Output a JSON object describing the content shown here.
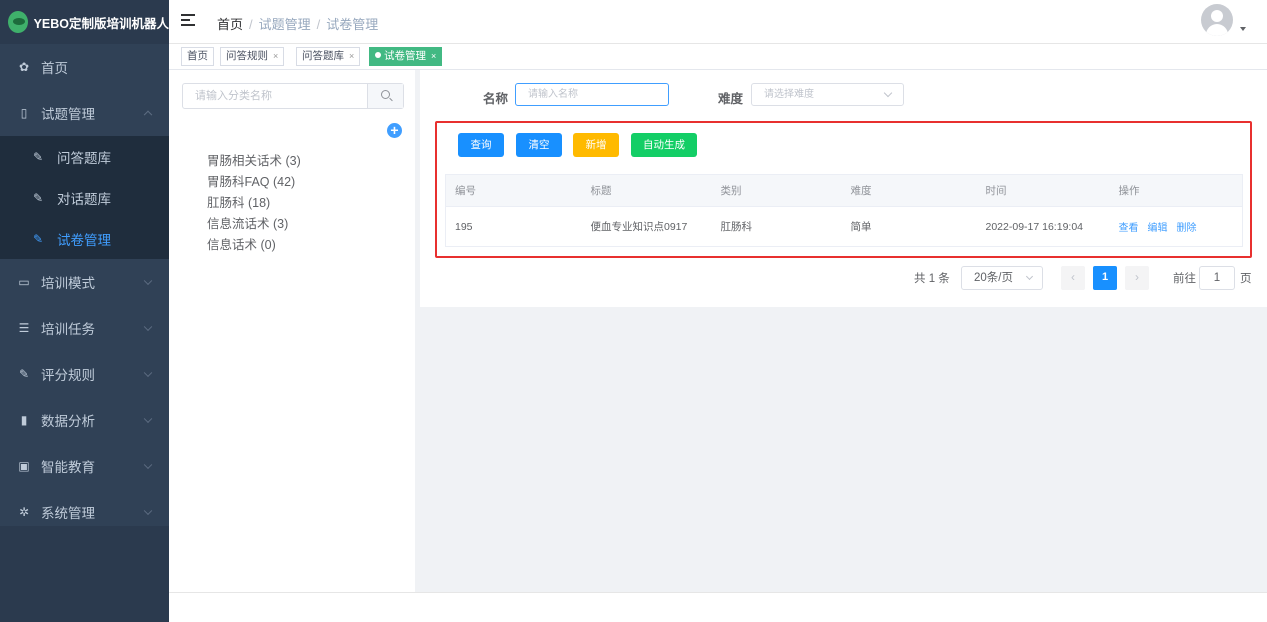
{
  "app": {
    "title": "YEBO定制版培训机器人"
  },
  "sidebar": {
    "items": [
      {
        "label": "首页",
        "icon": "dashboard-icon",
        "glyph": "✿"
      },
      {
        "label": "试题管理",
        "icon": "book-icon",
        "glyph": "▯",
        "expanded": true,
        "children": [
          {
            "label": "问答题库",
            "icon": "edit-icon",
            "glyph": "✎"
          },
          {
            "label": "对话题库",
            "icon": "edit-icon",
            "glyph": "✎"
          },
          {
            "label": "试卷管理",
            "icon": "edit-icon",
            "glyph": "✎",
            "active": true
          }
        ]
      },
      {
        "label": "培训模式",
        "icon": "monitor-icon",
        "glyph": "▭"
      },
      {
        "label": "培训任务",
        "icon": "list-icon",
        "glyph": "☰"
      },
      {
        "label": "评分规则",
        "icon": "edit-icon",
        "glyph": "✎"
      },
      {
        "label": "数据分析",
        "icon": "bar-chart-icon",
        "glyph": "▮"
      },
      {
        "label": "智能教育",
        "icon": "screen-icon",
        "glyph": "▣"
      },
      {
        "label": "系统管理",
        "icon": "gear-icon",
        "glyph": "✲"
      }
    ]
  },
  "header": {
    "breadcrumb": {
      "home": "首页",
      "parent": "试题管理",
      "current": "试卷管理"
    }
  },
  "tags": [
    {
      "label": "首页",
      "closable": false
    },
    {
      "label": "问答规则",
      "closable": true
    },
    {
      "label": "问答题库",
      "closable": true
    },
    {
      "label": "试卷管理",
      "closable": true,
      "active": true
    }
  ],
  "tree": {
    "search_placeholder": "请输入分类名称",
    "nodes": [
      "胃肠相关话术 (3)",
      "胃肠科FAQ (42)",
      "肛肠科 (18)",
      "信息流话术 (3)",
      "信息话术 (0)"
    ]
  },
  "filters": {
    "name_label": "名称",
    "name_placeholder": "请输入名称",
    "difficulty_label": "难度",
    "difficulty_placeholder": "请选择难度"
  },
  "buttons": {
    "query": "查询",
    "clear": "清空",
    "add": "新增",
    "auto": "自动生成"
  },
  "table": {
    "columns": [
      "编号",
      "标题",
      "类别",
      "难度",
      "时间",
      "操作"
    ],
    "rows": [
      {
        "id": "195",
        "title": "便血专业知识点0917",
        "category": "肛肠科",
        "difficulty": "简单",
        "time": "2022-09-17 16:19:04",
        "actions": [
          "查看",
          "编辑",
          "删除"
        ]
      }
    ]
  },
  "pagination": {
    "total": "共 1 条",
    "page_size": "20条/页",
    "current_page": "1",
    "goto_label": "前往",
    "goto_value": "1",
    "page_suffix": "页"
  },
  "colors": {
    "primary": "#1890ff",
    "warning": "#ffba00",
    "success": "#13ce66",
    "highlight": "#e8302f",
    "sidebar": "#304156"
  }
}
